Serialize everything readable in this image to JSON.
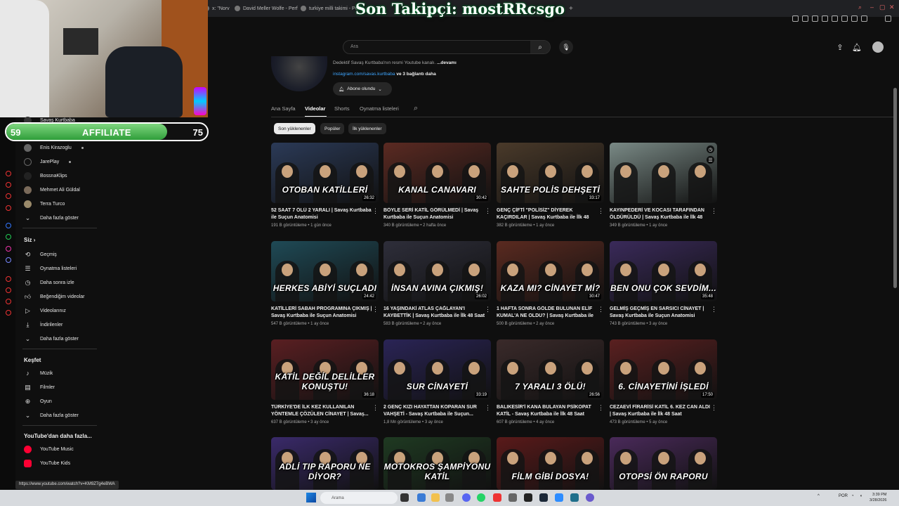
{
  "browser": {
    "tabs": [
      {
        "label": "x: \"Norv"
      },
      {
        "label": "David Meller Wolfe - Perf"
      },
      {
        "label": "turkiye milli takimi - Perf"
      }
    ],
    "new_tab": "+"
  },
  "stream_overlay": {
    "title": "Son Takipçi: mostRRcsgo",
    "affiliate": {
      "label": "AFFILIATE",
      "start": "59",
      "end": "75",
      "progress": 0.8
    }
  },
  "youtube": {
    "search_placeholder": "Ara",
    "channel": {
      "description": "Dedektif Savaş Kurtbaba'nın resmi Youtube kanalı.",
      "more": "...devamı",
      "link": "instagram.com/savas.kurtbaba",
      "link_suffix": "ve 3 bağlantı daha",
      "subscribe_label": "Abone olundu"
    },
    "tabs": [
      "Ana Sayfa",
      "Videolar",
      "Shorts",
      "Oynatma listeleri"
    ],
    "active_tab": "Videolar",
    "chips": [
      "Son yüklenenler",
      "Popüler",
      "İlk yüklenenler"
    ],
    "active_chip": "Son yüklenenler"
  },
  "sidebar": {
    "subscriptions": [
      {
        "label": "Savaş Kurtbaba"
      },
      {
        "label": "Enis Kirazoglu"
      },
      {
        "label": "JarePlay"
      },
      {
        "label": "BossnaKlips"
      },
      {
        "label": "Mehmet Ali Güldal"
      },
      {
        "label": "Terra Turco"
      },
      {
        "label": "Daha fazla göster"
      }
    ],
    "siz_header": "Siz",
    "siz_items": [
      {
        "label": "Geçmiş",
        "icon": "history-icon"
      },
      {
        "label": "Oynatma listeleri",
        "icon": "playlist-icon"
      },
      {
        "label": "Daha sonra izle",
        "icon": "clock-icon"
      },
      {
        "label": "Beğendiğim videolar",
        "icon": "thumbs-up-icon"
      },
      {
        "label": "Videolarınız",
        "icon": "video-icon"
      },
      {
        "label": "İndirilenler",
        "icon": "download-icon"
      },
      {
        "label": "Daha fazla göster",
        "icon": "chevron-down-icon"
      }
    ],
    "kesfet_header": "Keşfet",
    "kesfet_items": [
      {
        "label": "Müzik",
        "icon": "music-icon"
      },
      {
        "label": "Filmler",
        "icon": "film-icon"
      },
      {
        "label": "Oyun",
        "icon": "gamepad-icon"
      },
      {
        "label": "Daha fazla göster",
        "icon": "chevron-down-icon"
      }
    ],
    "more_header": "YouTube'dan daha fazla...",
    "more_items": [
      {
        "label": "YouTube Music"
      },
      {
        "label": "YouTube Kids"
      }
    ]
  },
  "videos": [
    {
      "thumb_text": "OTOBAN KATİLLERİ",
      "duration": "26:32",
      "title": "52 SAAT 7 ÖLÜ 2 YARALI | Savaş Kurtbaba ile Suçun Anatomisi",
      "views": "191 B görüntüleme",
      "age": "1 gün önce",
      "color": "#2b3a57"
    },
    {
      "thumb_text": "KANAL CANAVARI",
      "duration": "30:42",
      "title": "BÖYLE SERİ KATİL GÖRÜLMEDİ | Savaş Kurtbaba ile Suçun Anatomisi",
      "views": "340 B görüntüleme",
      "age": "2 hafta önce",
      "color": "#5b2a22"
    },
    {
      "thumb_text": "SAHTE POLİS DEHŞETİ",
      "duration": "33:17",
      "title": "GENÇ ÇİFTİ \"POLİSİZ\" DİYEREK KAÇIRDILAR | Savaş Kurtbaba ile İlk 48 Saat",
      "views": "382 B görüntüleme",
      "age": "1 ay önce",
      "color": "#4a3a2a"
    },
    {
      "thumb_text": "",
      "duration": "",
      "title": "KAYINPEDERİ VE KOCASI TARAFINDAN ÖLDÜRÜLDÜ | Savaş Kurtbaba ile İlk 48 Saat",
      "views": "349 B görüntüleme",
      "age": "1 ay önce",
      "color": "#7a8a86"
    },
    {
      "thumb_text": "HERKES ABİYİ SUÇLADI",
      "duration": "24:42",
      "title": "KATİLLERİ SABAH PROGRAMINA ÇIKMIŞ | Savaş Kurtbaba ile Suçun Anatomisi",
      "views": "547 B görüntüleme",
      "age": "1 ay önce",
      "color": "#1f4a56"
    },
    {
      "thumb_text": "İNSAN AVINA ÇIKMIŞ!",
      "duration": "26:02",
      "title": "16 YAŞINDAKİ ATLAS ÇAĞLAYAN'I KAYBETTİK | Savaş Kurtbaba ile İlk 48 Saat",
      "views": "583 B görüntüleme",
      "age": "2 ay önce",
      "color": "#2e2e3a"
    },
    {
      "thumb_text": "KAZA MI? CİNAYET Mİ?",
      "duration": "30:47",
      "title": "1 HAFTA SONRA GÖLDE BULUNAN ELİF KUMAL'A NE OLDU? | Savaş Kurtbaba ile İlk...",
      "views": "500 B görüntüleme",
      "age": "2 ay önce",
      "color": "#5a2a20"
    },
    {
      "thumb_text": "BEN ONU ÇOK SEVDİM...",
      "duration": "35:48",
      "title": "GELMİŞ GEÇMİŞ EN SARSICI CİNAYET | Savaş Kurtbaba ile Suçun Anatomisi",
      "views": "743 B görüntüleme",
      "age": "3 ay önce",
      "color": "#3a2a5a"
    },
    {
      "thumb_text": "KATİL DEĞİL DELİLLER KONUŞTU!",
      "duration": "36:18",
      "title": "TÜRKİYE'DE İLK KEZ KULLANILAN YÖNTEMLE ÇÖZÜLEN CİNAYET | Savaş...",
      "views": "637 B görüntüleme",
      "age": "3 ay önce",
      "color": "#5a1f22"
    },
    {
      "thumb_text": "SUR CİNAYETİ",
      "duration": "33:19",
      "title": "2 GENÇ KIZI HAYATTAN KOPARAN SUR VAHŞETİ - Savaş Kurtbaba ile Suçun...",
      "views": "1,8 Mn görüntüleme",
      "age": "3 ay önce",
      "color": "#2a2456"
    },
    {
      "thumb_text": "7 YARALI 3 ÖLÜ!",
      "duration": "26:56",
      "title": "BALIKESİR'İ KANA BULAYAN PSİKOPAT KATİL - Savaş Kurtbaba ile İlk 48 Saat",
      "views": "607 B görüntüleme",
      "age": "4 ay önce",
      "color": "#3a2a2a"
    },
    {
      "thumb_text": "6. CİNAYETİNİ İŞLEDİ",
      "duration": "17:50",
      "title": "CEZAEVİ FİRARİSİ KATİL 6. KEZ CAN ALDI | Savaş Kurtbaba ile İlk 48 Saat",
      "views": "473 B görüntüleme",
      "age": "5 ay önce",
      "color": "#5a2020"
    },
    {
      "thumb_text": "ADLİ TIP RAPORU NE DİYOR?",
      "duration": "",
      "title": "",
      "views": "",
      "age": "",
      "color": "#3a2a6a"
    },
    {
      "thumb_text": "MOTOKROS ŞAMPİYONU KATİL",
      "duration": "",
      "title": "",
      "views": "",
      "age": "",
      "color": "#1f3a22"
    },
    {
      "thumb_text": "FİLM GİBİ DOSYA!",
      "duration": "",
      "title": "",
      "views": "",
      "age": "",
      "color": "#5a1a1a"
    },
    {
      "thumb_text": "OTOPSİ ÖN RAPORU",
      "duration": "",
      "title": "",
      "views": "",
      "age": "",
      "color": "#4a2a5a"
    }
  ],
  "status_url": "https://www.youtube.com/watch?v=KM9Z7g4eBWA",
  "taskbar": {
    "search_placeholder": "Arama",
    "lang": "POR",
    "time": "3:39 PM",
    "date": "3/28/2026"
  }
}
